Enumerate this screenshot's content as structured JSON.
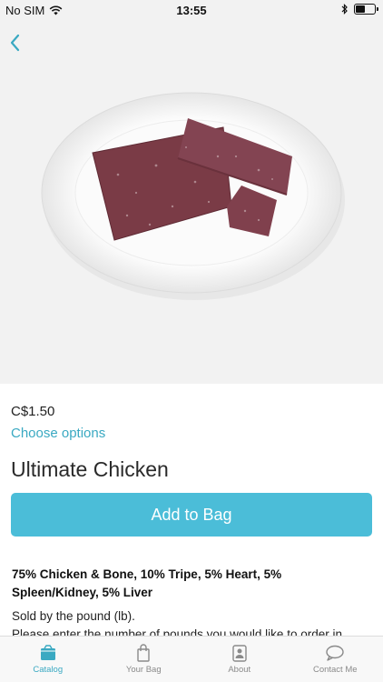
{
  "status_bar": {
    "carrier": "No SIM",
    "time": "13:55",
    "battery_level": 0.55
  },
  "product": {
    "price": "C$1.50",
    "choose_options": "Choose options",
    "title": "Ultimate Chicken",
    "add_to_bag": "Add to Bag",
    "composition": "75% Chicken & Bone, 10% Tripe, 5% Heart, 5% Spleen/Kidney, 5% Liver",
    "sold_by": "Sold by the pound (lb).",
    "order_note": "Please enter the number of pounds you would like to order in"
  },
  "tabs": [
    {
      "label": "Catalog",
      "icon": "catalog-icon",
      "active": true
    },
    {
      "label": "Your Bag",
      "icon": "bag-icon",
      "active": false
    },
    {
      "label": "About",
      "icon": "about-icon",
      "active": false
    },
    {
      "label": "Contact Me",
      "icon": "chat-icon",
      "active": false
    }
  ],
  "colors": {
    "accent": "#4bbdd8",
    "link": "#3aa9c2",
    "meat": "#7a3b46"
  }
}
